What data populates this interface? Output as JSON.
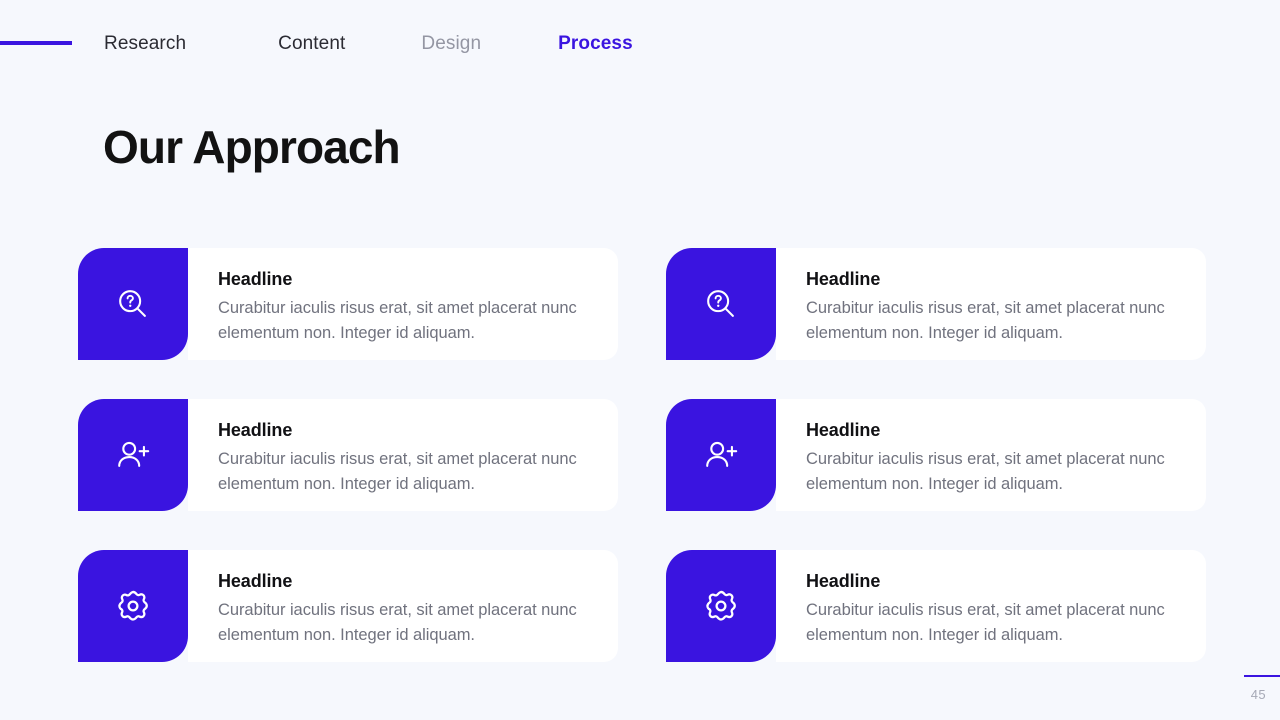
{
  "nav": {
    "rule_color": "#3A14E0",
    "items": [
      {
        "label": "Research",
        "state": "dark"
      },
      {
        "label": "Content",
        "state": "dark"
      },
      {
        "label": "Design",
        "state": "muted"
      },
      {
        "label": "Process",
        "state": "active"
      }
    ]
  },
  "title": "Our Approach",
  "theme": {
    "background": "#F6F8FD",
    "accent": "#3A14E0",
    "card_surface": "#FFFFFF",
    "heading_color": "#111114",
    "body_color": "#70727E",
    "muted_color": "#9496A3"
  },
  "cards": [
    {
      "icon": "search-question-icon",
      "headline": "Headline",
      "text": "Curabitur iaculis risus erat, sit amet placerat nunc elementum non. Integer id aliquam."
    },
    {
      "icon": "search-question-icon",
      "headline": "Headline",
      "text": "Curabitur iaculis risus erat, sit amet placerat nunc elementum non. Integer id aliquam."
    },
    {
      "icon": "user-plus-icon",
      "headline": "Headline",
      "text": "Curabitur iaculis risus erat, sit amet placerat nunc elementum non. Integer id aliquam."
    },
    {
      "icon": "user-plus-icon",
      "headline": "Headline",
      "text": "Curabitur iaculis risus erat, sit amet placerat nunc elementum non. Integer id aliquam."
    },
    {
      "icon": "gear-icon",
      "headline": "Headline",
      "text": "Curabitur iaculis risus erat, sit amet placerat nunc elementum non. Integer id aliquam."
    },
    {
      "icon": "gear-icon",
      "headline": "Headline",
      "text": "Curabitur iaculis risus erat, sit amet placerat nunc elementum non. Integer id aliquam."
    }
  ],
  "footer": {
    "page_number": "45"
  }
}
